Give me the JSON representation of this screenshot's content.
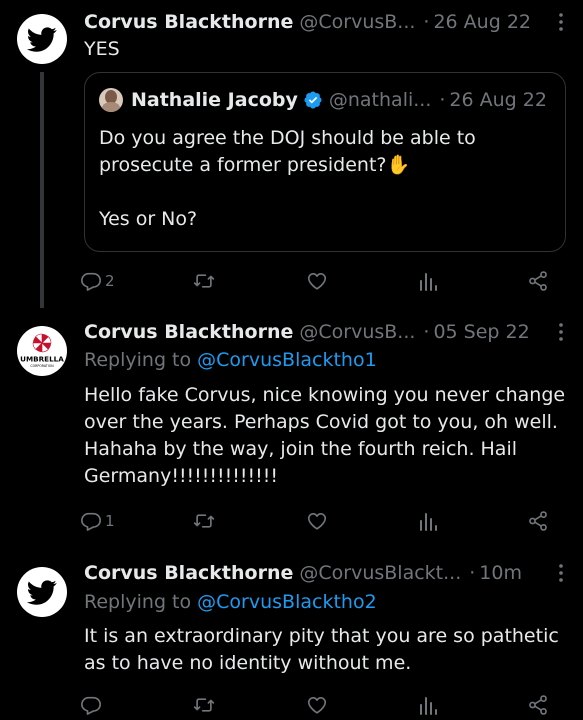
{
  "tweets": [
    {
      "name": "Corvus Blackthorne",
      "handle": "@CorvusB...",
      "separator": "·",
      "time": "26 Aug 22",
      "text": "YES",
      "quote": {
        "name": "Nathalie Jacoby",
        "handle": "@nathali...",
        "separator": "·",
        "time": "26 Aug 22",
        "text": "Do you agree the DOJ should be able to prosecute a former president?✋\n\nYes or No?"
      },
      "actions": {
        "reply_count": "2",
        "retweet_count": "",
        "like_count": ""
      }
    },
    {
      "name": "Corvus Blackthorne",
      "handle": "@CorvusB...",
      "separator": "·",
      "time": "05 Sep 22",
      "reply_prefix": "Replying to ",
      "reply_to": "@CorvusBlacktho1",
      "avatar_text": "UMBRELLA",
      "avatar_subtext": "CORPORATION",
      "text": "Hello fake Corvus, nice knowing you never change over the years. Perhaps Covid got to you, oh well. Hahaha by the way, join the fourth reich. Hail Germany!!!!!!!!!!!!!!",
      "actions": {
        "reply_count": "1",
        "retweet_count": "",
        "like_count": ""
      }
    },
    {
      "name": "Corvus Blackthorne",
      "handle": "@CorvusBlackt...",
      "separator": "·",
      "time": "10m",
      "reply_prefix": "Replying to ",
      "reply_to": "@CorvusBlacktho2",
      "text": "It is an extraordinary pity that you are so pathetic as to have no identity without me.",
      "actions": {
        "reply_count": "",
        "retweet_count": "",
        "like_count": ""
      }
    }
  ],
  "icons": [
    "twitter-bird-icon",
    "umbrella-logo-icon",
    "more-icon",
    "verified-icon",
    "reply-icon",
    "retweet-icon",
    "like-icon",
    "views-icon",
    "share-icon"
  ],
  "colors": {
    "background": "#000000",
    "text": "#e7e9ea",
    "muted": "#71767b",
    "link": "#1d9bf0",
    "verified": "#1d9bf0",
    "border": "#2f3336"
  }
}
